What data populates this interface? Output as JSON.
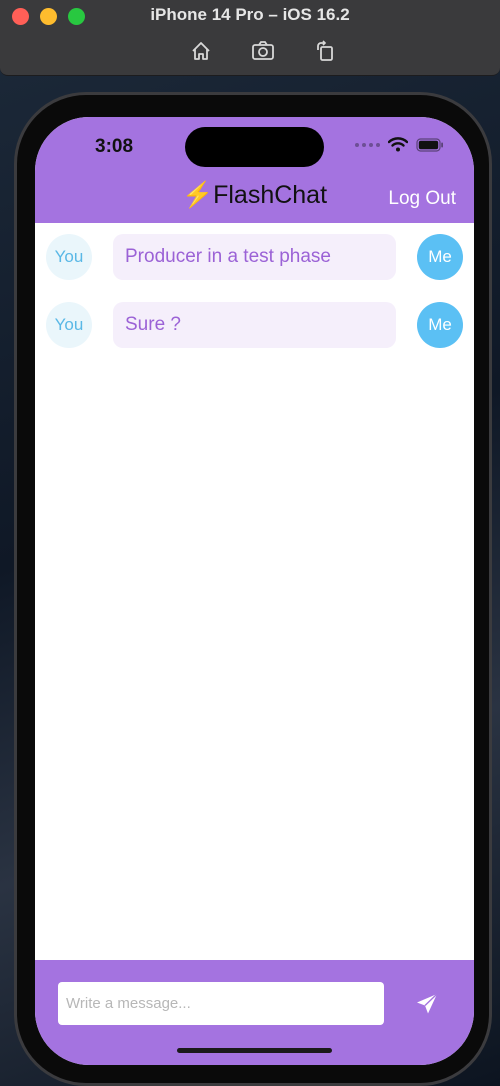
{
  "simulator": {
    "title": "iPhone 14 Pro – iOS 16.2",
    "toolbar": [
      "home-icon",
      "screenshot-icon",
      "rotate-icon"
    ]
  },
  "status_bar": {
    "time": "3:08"
  },
  "header": {
    "logo_symbol": "⚡",
    "title": "FlashChat",
    "logout_label": "Log Out"
  },
  "messages": [
    {
      "left_avatar": "You",
      "text": "Producer in a test phase",
      "right_avatar": "Me"
    },
    {
      "left_avatar": "You",
      "text": "Sure ?",
      "right_avatar": "Me"
    }
  ],
  "composer": {
    "placeholder": "Write a message...",
    "value": ""
  },
  "colors": {
    "brand_purple": "#a473e0",
    "me_avatar": "#5bc0f4",
    "bubble_bg": "#f5effb",
    "bubble_text": "#9b62d6",
    "you_avatar_bg": "#eaf6fb",
    "you_avatar_text": "#5ab8e6"
  }
}
